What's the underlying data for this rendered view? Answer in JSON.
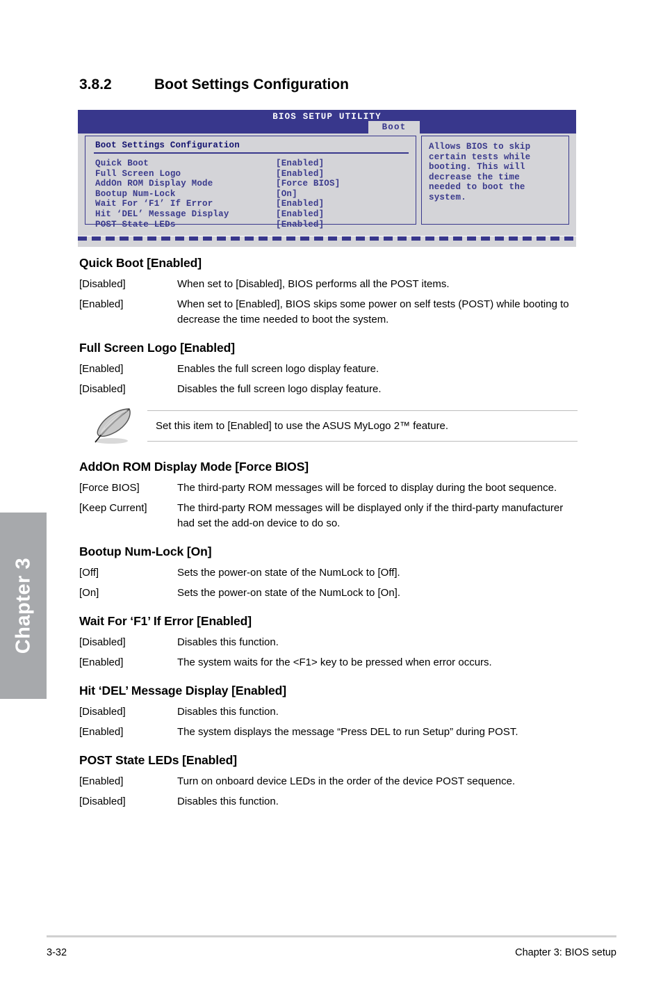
{
  "chapter_tab": {
    "label": "Chapter 3"
  },
  "section": {
    "number": "3.8.2",
    "title": "Boot Settings Configuration"
  },
  "bios_screen": {
    "title": "BIOS SETUP UTILITY",
    "active_tab": "Boot",
    "panel_title": "Boot Settings Configuration",
    "settings": [
      {
        "label": "Quick Boot",
        "value": "[Enabled]"
      },
      {
        "label": "Full Screen Logo",
        "value": "[Enabled]"
      },
      {
        "label": "AddOn ROM Display Mode",
        "value": "[Force BIOS]"
      },
      {
        "label": "Bootup Num-Lock",
        "value": "[On]"
      },
      {
        "label": "Wait For ‘F1’ If Error",
        "value": "[Enabled]"
      },
      {
        "label": "Hit ‘DEL’ Message Display",
        "value": "[Enabled]"
      },
      {
        "label": "POST State LEDs",
        "value": "[Enabled]"
      }
    ],
    "help_text": "Allows BIOS to skip\ncertain tests while\nbooting. This will\ndecrease the time\nneeded to boot the\nsystem.",
    "colors": {
      "header_blue": "#38378c",
      "panel_gray": "#d4d4d8",
      "text_blue": "#3a3a8c"
    }
  },
  "items": [
    {
      "title": "Quick Boot [Enabled]",
      "options": [
        {
          "key": "[Disabled]",
          "desc": "When set to [Disabled], BIOS performs all the POST items."
        },
        {
          "key": "[Enabled]",
          "desc": "When set to [Enabled], BIOS skips some power on self tests (POST) while booting to decrease the time needed to boot the system."
        }
      ]
    },
    {
      "title": "Full Screen Logo [Enabled]",
      "options": [
        {
          "key": "[Enabled]",
          "desc": "Enables the full screen logo display feature."
        },
        {
          "key": "[Disabled]",
          "desc": "Disables the full screen logo display feature."
        }
      ]
    },
    {
      "title": "AddOn ROM Display Mode [Force BIOS]",
      "options": [
        {
          "key": "[Force BIOS]",
          "desc": "The third-party ROM messages will be forced to display during the boot sequence."
        },
        {
          "key": "[Keep Current]",
          "desc": "The third-party ROM messages will be displayed only if the third-party manufacturer had set the add-on device to do so."
        }
      ]
    },
    {
      "title": "Bootup Num-Lock [On]",
      "options": [
        {
          "key": "[Off]",
          "desc": "Sets the power-on state of the NumLock to [Off]."
        },
        {
          "key": "[On]",
          "desc": "Sets the power-on state of the NumLock to [On]."
        }
      ]
    },
    {
      "title": "Wait For ‘F1’ If Error [Enabled]",
      "options": [
        {
          "key": "[Disabled]",
          "desc": "Disables this function."
        },
        {
          "key": "[Enabled]",
          "desc": "The system waits for the <F1> key to be pressed when error occurs."
        }
      ]
    },
    {
      "title": "Hit ‘DEL’ Message Display [Enabled]",
      "options": [
        {
          "key": "[Disabled]",
          "desc": "Disables this function."
        },
        {
          "key": "[Enabled]",
          "desc": "The system displays the message “Press DEL to run Setup” during POST."
        }
      ]
    },
    {
      "title": "POST State LEDs [Enabled]",
      "options": [
        {
          "key": "[Enabled]",
          "desc": "Turn on onboard device LEDs in the order of the device POST sequence."
        },
        {
          "key": "[Disabled]",
          "desc": "Disables this function."
        }
      ]
    }
  ],
  "note": {
    "text": "Set this item to [Enabled] to use the ASUS MyLogo 2™ feature.",
    "icon": "quill-pen-icon"
  },
  "footer": {
    "page_number": "3-32",
    "chapter_label": "Chapter 3: BIOS setup"
  }
}
